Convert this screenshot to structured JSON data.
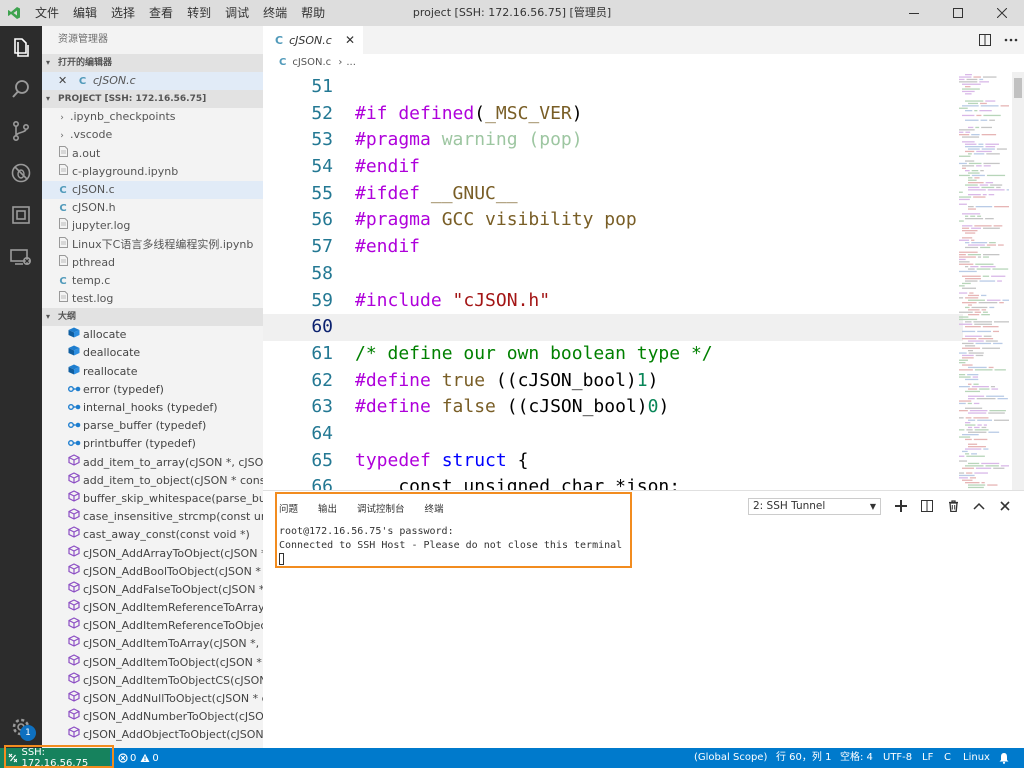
{
  "titlebar": {
    "menu": [
      "文件",
      "编辑",
      "选择",
      "查看",
      "转到",
      "调试",
      "终端",
      "帮助"
    ],
    "title": "project [SSH: 172.16.56.75] [管理员]"
  },
  "sidebar": {
    "title": "资源管理器",
    "open_editors_header": "打开的编辑器",
    "open_editors": [
      {
        "icon": "C",
        "label": "cJSON.c"
      }
    ],
    "project_header": "PROJECT [SSH: 172.16.56.75]",
    "files": [
      {
        "label": ".ipynb_checkpoints",
        "type": "folder"
      },
      {
        "label": ".vscode",
        "type": "folder"
      },
      {
        "label": "a.out",
        "type": "file"
      },
      {
        "label": "c-playground.ipynb",
        "type": "file"
      },
      {
        "label": "cJSON.c",
        "type": "c"
      },
      {
        "label": "cJSON.h",
        "type": "c"
      },
      {
        "label": "jupyter.log",
        "type": "file"
      },
      {
        "label": "Linux下C语言多线程编程实例.ipynb",
        "type": "file"
      },
      {
        "label": "pthread",
        "type": "file"
      },
      {
        "label": "temp.c",
        "type": "c"
      },
      {
        "label": "test.log",
        "type": "file"
      }
    ],
    "outline_header": "大纲",
    "outline": [
      {
        "label": "allocate",
        "kind": "field"
      },
      {
        "label": "deallocate",
        "kind": "field"
      },
      {
        "label": "reallocate",
        "kind": "field"
      },
      {
        "label": "error (typedef)",
        "kind": "typedef"
      },
      {
        "label": "internal_hooks (typedef)",
        "kind": "typedef"
      },
      {
        "label": "parse_buffer (typedef)",
        "kind": "typedef"
      },
      {
        "label": "printbuffer (typedef)",
        "kind": "typedef"
      },
      {
        "label": "add_item_to_array(cJSON *, cJSON *)",
        "kind": "function"
      },
      {
        "label": "add_item_to_object(cJSON * const, ...",
        "kind": "function"
      },
      {
        "label": "buffer_skip_whitespace(parse_buffe...",
        "kind": "function"
      },
      {
        "label": "case_insensitive_strcmp(const unsig...",
        "kind": "function"
      },
      {
        "label": "cast_away_const(const void *)",
        "kind": "function"
      },
      {
        "label": "cJSON_AddArrayToObject(cJSON * ...",
        "kind": "function"
      },
      {
        "label": "cJSON_AddBoolToObject(cJSON * c...",
        "kind": "function"
      },
      {
        "label": "cJSON_AddFalseToObject(cJSON * ...",
        "kind": "function"
      },
      {
        "label": "cJSON_AddItemReferenceToArray(c...",
        "kind": "function"
      },
      {
        "label": "cJSON_AddItemReferenceToObject(...",
        "kind": "function"
      },
      {
        "label": "cJSON_AddItemToArray(cJSON *, cJ...",
        "kind": "function"
      },
      {
        "label": "cJSON_AddItemToObject(cJSON * , ...",
        "kind": "function"
      },
      {
        "label": "cJSON_AddItemToObjectCS(cJSON ...",
        "kind": "function"
      },
      {
        "label": "cJSON_AddNullToObject(cJSON * c...",
        "kind": "function"
      },
      {
        "label": "cJSON_AddNumberToObject(cJSO...",
        "kind": "function"
      },
      {
        "label": "cJSON_AddObjectToObject(cJSON ...",
        "kind": "function"
      }
    ]
  },
  "editor": {
    "tab_label": "cJSON.c",
    "tab_icon": "C",
    "breadcrumb_file": "cJSON.c",
    "breadcrumb_more": "...",
    "lines": [
      {
        "n": "51",
        "tokens": []
      },
      {
        "n": "52",
        "tokens": [
          {
            "t": "#if defined",
            "c": "t-kw"
          },
          {
            "t": "(",
            "c": "t-pl"
          },
          {
            "t": "_MSC_VER",
            "c": "t-mac"
          },
          {
            "t": ")",
            "c": "t-pl"
          }
        ]
      },
      {
        "n": "53",
        "tokens": [
          {
            "t": "#pragma ",
            "c": "t-kw"
          },
          {
            "t": "warning ",
            "c": "t-pragma-faded"
          },
          {
            "t": "(pop)",
            "c": "t-pragma-faded"
          }
        ]
      },
      {
        "n": "54",
        "tokens": [
          {
            "t": "#endif",
            "c": "t-kw"
          }
        ]
      },
      {
        "n": "55",
        "tokens": [
          {
            "t": "#ifdef ",
            "c": "t-kw"
          },
          {
            "t": "__GNUC__",
            "c": "t-mac"
          }
        ]
      },
      {
        "n": "56",
        "tokens": [
          {
            "t": "#pragma ",
            "c": "t-kw"
          },
          {
            "t": "GCC visibility pop",
            "c": "t-mac"
          }
        ]
      },
      {
        "n": "57",
        "tokens": [
          {
            "t": "#endif",
            "c": "t-kw"
          }
        ]
      },
      {
        "n": "58",
        "tokens": []
      },
      {
        "n": "59",
        "tokens": [
          {
            "t": "#include ",
            "c": "t-kw"
          },
          {
            "t": "\"cJSON.h\"",
            "c": "t-str"
          }
        ]
      },
      {
        "n": "60",
        "tokens": [],
        "current": true
      },
      {
        "n": "61",
        "tokens": [
          {
            "t": "/* define our own boolean type */",
            "c": "t-cm"
          }
        ]
      },
      {
        "n": "62",
        "tokens": [
          {
            "t": "#define ",
            "c": "t-kw"
          },
          {
            "t": "true ",
            "c": "t-mac"
          },
          {
            "t": "((cJSON_bool)",
            "c": "t-pl"
          },
          {
            "t": "1",
            "c": "t-num"
          },
          {
            "t": ")",
            "c": "t-pl"
          }
        ]
      },
      {
        "n": "63",
        "tokens": [
          {
            "t": "#define ",
            "c": "t-kw"
          },
          {
            "t": "false ",
            "c": "t-mac"
          },
          {
            "t": "((cJSON_bool)",
            "c": "t-pl"
          },
          {
            "t": "0",
            "c": "t-num"
          },
          {
            "t": ")",
            "c": "t-pl"
          }
        ]
      },
      {
        "n": "64",
        "tokens": []
      },
      {
        "n": "65",
        "tokens": [
          {
            "t": "typedef ",
            "c": "t-kw"
          },
          {
            "t": "struct ",
            "c": "t-dir"
          },
          {
            "t": "{",
            "c": "t-pl"
          }
        ]
      },
      {
        "n": "66",
        "tokens": [
          {
            "t": "    const unsigned char *json;",
            "c": "t-pl"
          }
        ]
      }
    ]
  },
  "panel": {
    "tabs": [
      "问题",
      "输出",
      "调试控制台",
      "终端"
    ],
    "terminal_select": "2: SSH Tunnel",
    "terminal_lines": [
      "root@172.16.56.75's password:",
      "Connected to SSH Host - Please do not close this terminal"
    ]
  },
  "statusbar": {
    "remote": "SSH: 172.16.56.75",
    "errors": "0",
    "warnings": "0",
    "scope": "(Global Scope)",
    "position": "行 60，列 1",
    "indent": "空格: 4",
    "encoding": "UTF-8",
    "eol": "LF",
    "language": "C",
    "os": "Linux"
  },
  "activitybar": {
    "icons": [
      "files-icon",
      "search-icon",
      "source-control-icon",
      "debug-icon",
      "extensions-icon",
      "remote-explorer-icon"
    ],
    "badge": "1"
  },
  "colors": {
    "accent": "#007acc",
    "remote": "#16825d",
    "highlight": "#f28c1f",
    "activity_bar": "#2c2c2c"
  }
}
